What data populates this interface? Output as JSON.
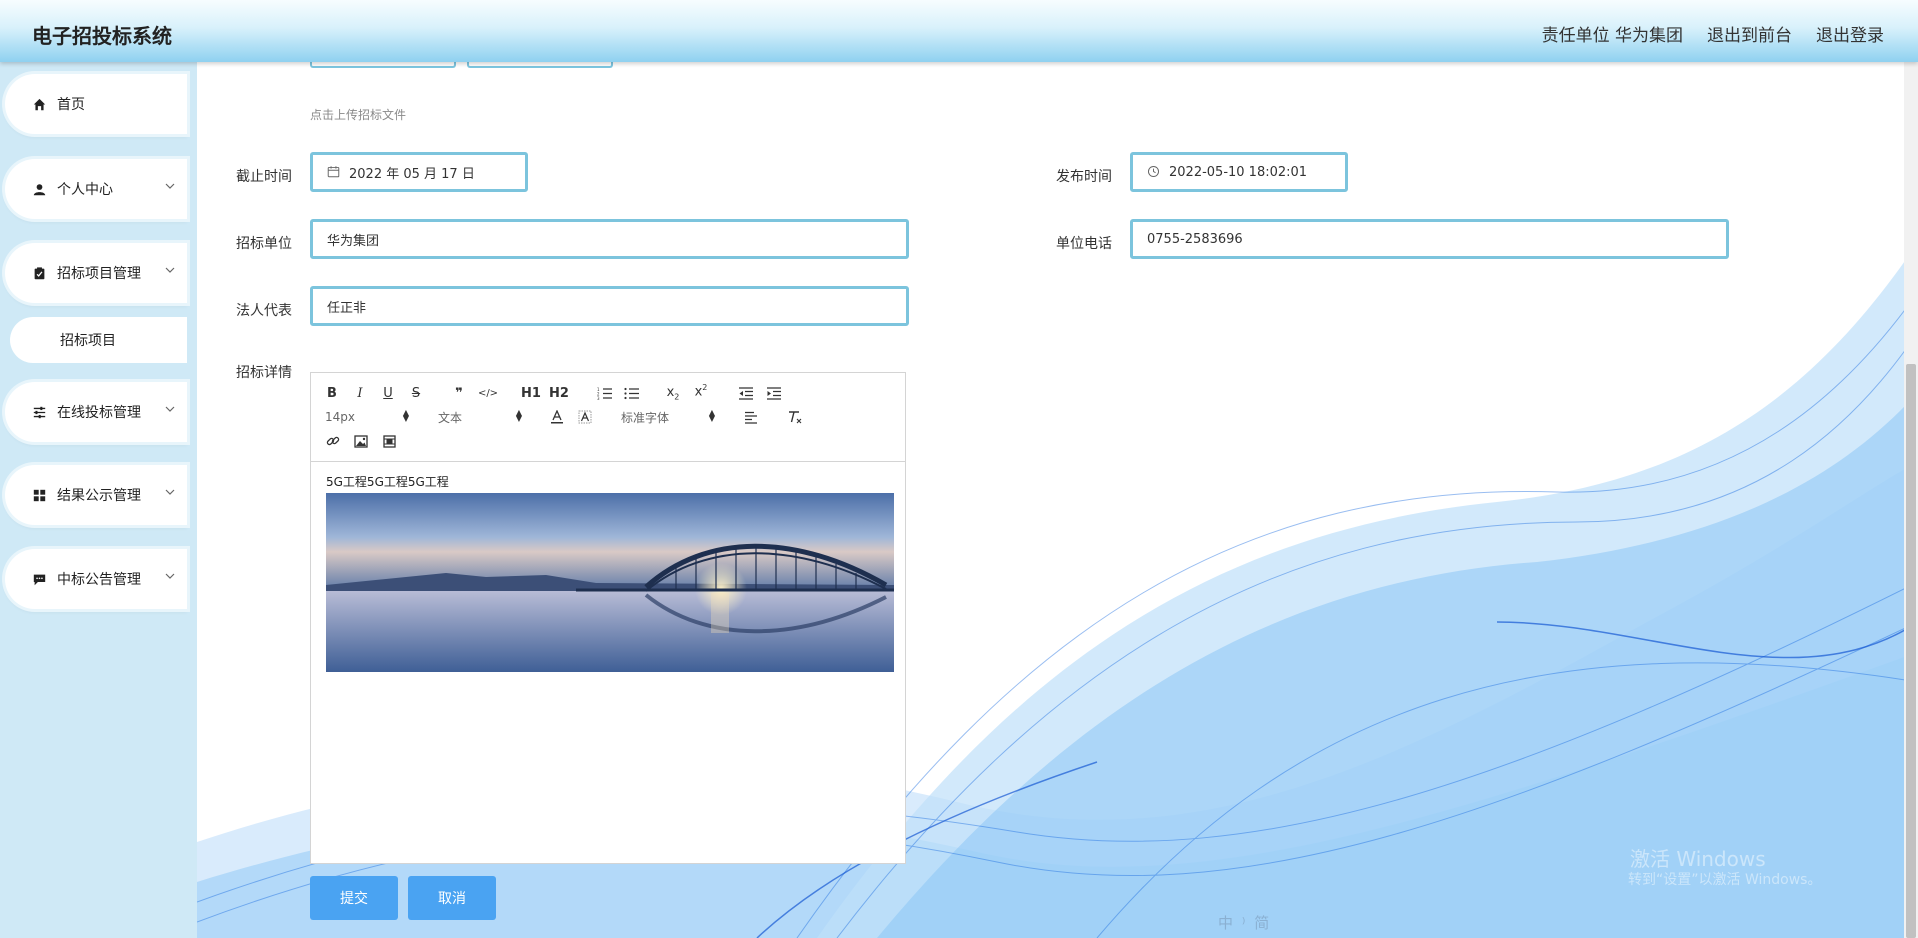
{
  "header": {
    "title": "电子招投标系统",
    "unit_label": "责任单位 华为集团",
    "back_frontend": "退出到前台",
    "logout": "退出登录"
  },
  "sidebar": {
    "items": [
      {
        "label": "首页",
        "icon": "home-icon"
      },
      {
        "label": "个人中心",
        "icon": "user-icon"
      },
      {
        "label": "招标项目管理",
        "icon": "clipboard-icon"
      },
      {
        "label": "在线投标管理",
        "icon": "sliders-icon"
      },
      {
        "label": "结果公示管理",
        "icon": "grid-icon"
      },
      {
        "label": "中标公告管理",
        "icon": "message-icon"
      }
    ],
    "sub_item": "招标项目"
  },
  "form": {
    "upload_hint": "点击上传招标文件",
    "deadline_label": "截止时间",
    "deadline_value": "2022 年 05 月 17 日",
    "publish_label": "发布时间",
    "publish_value": "2022-05-10 18:02:01",
    "bidder_unit_label": "招标单位",
    "bidder_unit_value": "华为集团",
    "phone_label": "单位电话",
    "phone_value": "0755-2583696",
    "legal_rep_label": "法人代表",
    "legal_rep_value": "任正非",
    "details_label": "招标详情"
  },
  "editor": {
    "toolbar": {
      "row1": [
        "B",
        "I",
        "U",
        "S",
        "❞",
        "</>",
        "H1",
        "H2",
        "ol",
        "ul",
        "x2",
        "x2"
      ],
      "size": "14px",
      "format": "文本",
      "font": "标准字体"
    },
    "content": "5G工程5G工程5G工程"
  },
  "buttons": {
    "submit": "提交",
    "cancel": "取消"
  },
  "watermark": {
    "line1": "激活 Windows",
    "line2": "转到“设置”以激活 Windows。"
  },
  "ime_bar": "中 ⁾ 简"
}
